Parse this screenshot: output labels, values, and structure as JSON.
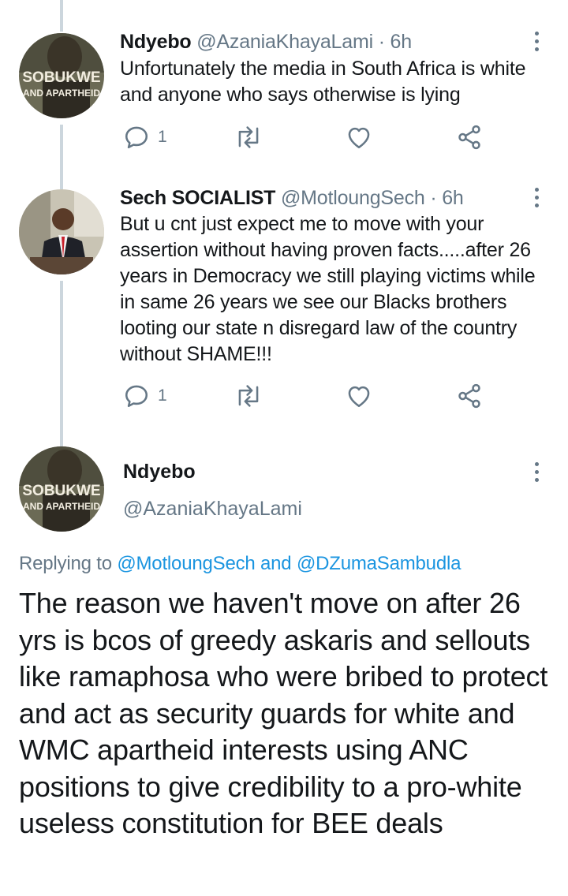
{
  "tweets": [
    {
      "name": "Ndyebo",
      "handle": "@AzaniaKhayaLami",
      "time": "· 6h",
      "text": "Unfortunately the media in South Africa is white and anyone who says otherwise is lying",
      "reply_count": "1",
      "avatar_text_1": "SOBUKWE",
      "avatar_text_2": "AND APARTHEID"
    },
    {
      "name": "Sech SOCIALIST",
      "handle": "@MotloungSech",
      "time": "· 6h",
      "text": "But u cnt just expect me to move with your assertion without having proven facts.....after 26 years in Democracy we still playing victims while in same 26 years we see our Blacks brothers looting our state n disregard law of the country without SHAME!!!",
      "reply_count": "1"
    }
  ],
  "main_tweet": {
    "name": "Ndyebo",
    "handle": "@AzaniaKhayaLami",
    "replying_prefix": "Replying to",
    "replying_to_1": "@MotloungSech",
    "replying_and": "and",
    "replying_to_2": "@DZumaSambudla",
    "text": "The reason we haven't move on after 26 yrs is bcos of greedy askaris and sellouts like ramaphosa who were bribed to protect and act as security guards for white and WMC apartheid interests using ANC positions to give credibility to a pro-white useless constitution for BEE deals",
    "avatar_text_1": "SOBUKWE",
    "avatar_text_2": "AND APARTHEID"
  },
  "colors": {
    "secondary_text": "#657786",
    "link": "#1b95e0",
    "thread_line": "#ccd6dd"
  },
  "icons": [
    "reply-icon",
    "retweet-icon",
    "like-icon",
    "share-icon",
    "more-icon"
  ]
}
